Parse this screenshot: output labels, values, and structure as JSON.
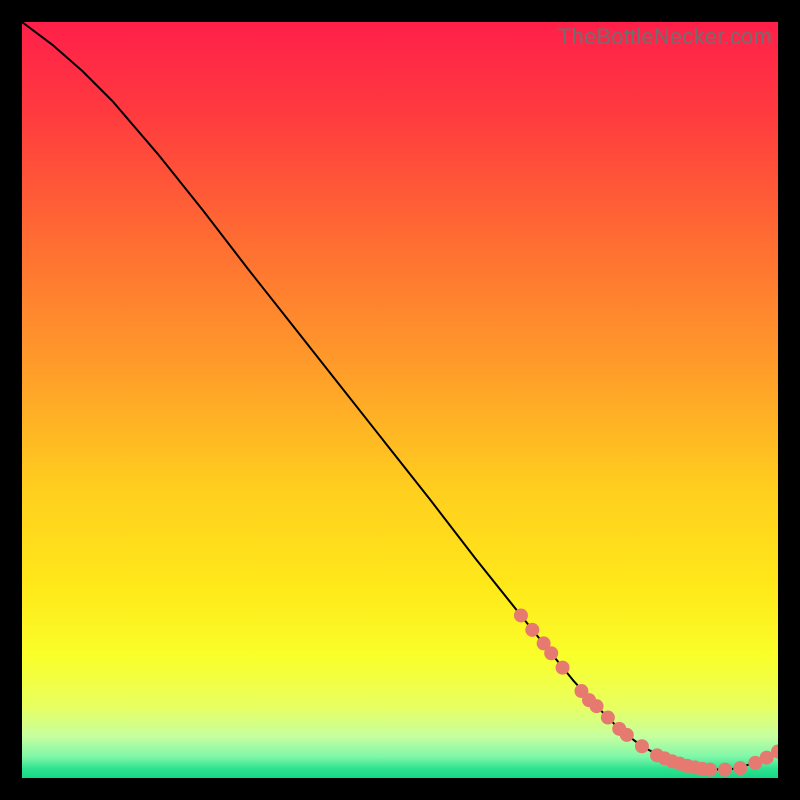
{
  "watermark": "TheBottleNecker.com",
  "colors": {
    "gradient_stops": [
      {
        "offset": 0.0,
        "color": "#ff1f4a"
      },
      {
        "offset": 0.12,
        "color": "#ff3a3f"
      },
      {
        "offset": 0.28,
        "color": "#ff6a33"
      },
      {
        "offset": 0.45,
        "color": "#ff9a2a"
      },
      {
        "offset": 0.62,
        "color": "#ffcf1e"
      },
      {
        "offset": 0.75,
        "color": "#ffe91a"
      },
      {
        "offset": 0.84,
        "color": "#f9ff2a"
      },
      {
        "offset": 0.905,
        "color": "#e8ff60"
      },
      {
        "offset": 0.945,
        "color": "#c6ffa0"
      },
      {
        "offset": 0.972,
        "color": "#7ef7a8"
      },
      {
        "offset": 0.988,
        "color": "#2de28f"
      },
      {
        "offset": 1.0,
        "color": "#16d885"
      }
    ],
    "marker": "#e77a70",
    "curve": "#000000",
    "background": "#000000"
  },
  "chart_data": {
    "type": "line",
    "title": "",
    "xlabel": "",
    "ylabel": "",
    "xlim": [
      0,
      100
    ],
    "ylim": [
      0,
      100
    ],
    "grid": false,
    "series": [
      {
        "name": "bottleneck-curve",
        "x": [
          0,
          4,
          8,
          12,
          18,
          24,
          30,
          36,
          42,
          48,
          54,
          60,
          66,
          70,
          73,
          76,
          79,
          82,
          85,
          88,
          91,
          94,
          97,
          100
        ],
        "y": [
          100,
          97,
          93.5,
          89.5,
          82.5,
          75,
          67.2,
          59.6,
          52,
          44.4,
          36.8,
          29,
          21.5,
          16.5,
          12.8,
          9.5,
          6.5,
          4.2,
          2.6,
          1.6,
          1.1,
          1.2,
          2.0,
          3.5
        ]
      }
    ],
    "markers": {
      "name": "highlighted-points",
      "points": [
        {
          "x": 66,
          "y": 21.5
        },
        {
          "x": 67.5,
          "y": 19.6
        },
        {
          "x": 69,
          "y": 17.8
        },
        {
          "x": 70,
          "y": 16.5
        },
        {
          "x": 71.5,
          "y": 14.6
        },
        {
          "x": 74,
          "y": 11.5
        },
        {
          "x": 75,
          "y": 10.3
        },
        {
          "x": 76,
          "y": 9.5
        },
        {
          "x": 77.5,
          "y": 8.0
        },
        {
          "x": 79,
          "y": 6.5
        },
        {
          "x": 80,
          "y": 5.7
        },
        {
          "x": 82,
          "y": 4.2
        },
        {
          "x": 84,
          "y": 3.0
        },
        {
          "x": 85,
          "y": 2.6
        },
        {
          "x": 86,
          "y": 2.2
        },
        {
          "x": 87,
          "y": 1.9
        },
        {
          "x": 88,
          "y": 1.6
        },
        {
          "x": 89,
          "y": 1.4
        },
        {
          "x": 90,
          "y": 1.2
        },
        {
          "x": 91,
          "y": 1.1
        },
        {
          "x": 93,
          "y": 1.1
        },
        {
          "x": 95,
          "y": 1.3
        },
        {
          "x": 97,
          "y": 2.0
        },
        {
          "x": 98.5,
          "y": 2.7
        },
        {
          "x": 100,
          "y": 3.5
        }
      ]
    }
  }
}
